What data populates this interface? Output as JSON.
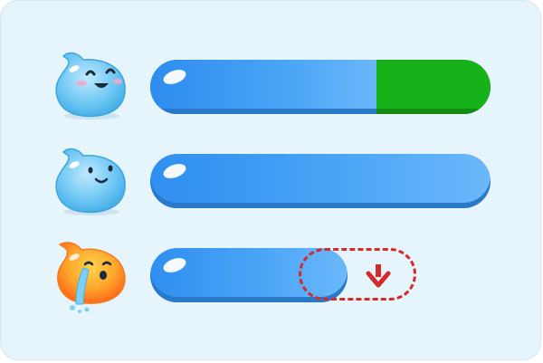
{
  "rows": [
    {
      "id": "happy",
      "mascot": "happy-blue-slime-icon",
      "progress": 0.67,
      "remaining_color": "#17b11a"
    },
    {
      "id": "neutral",
      "mascot": "smiling-blue-slime-icon",
      "progress": 1.0
    },
    {
      "id": "sad",
      "mascot": "crying-orange-slime-icon",
      "progress": 0.58,
      "missing_indicator": "down-arrow-icon"
    }
  ],
  "colors": {
    "background": "#e6f4fc",
    "bar_blue": "#3a98f2",
    "bar_green": "#17b11a",
    "dashed_red": "#d42a2a"
  }
}
